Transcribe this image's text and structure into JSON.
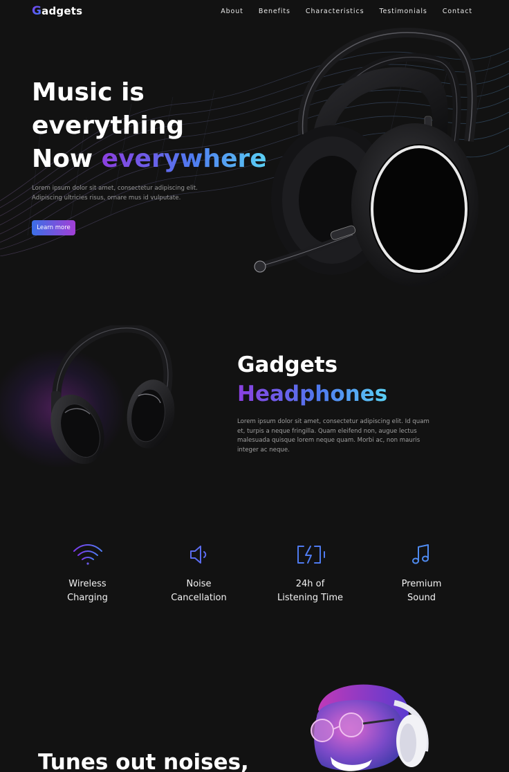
{
  "nav": {
    "logo_first": "G",
    "logo_rest": "adgets",
    "links": [
      "About",
      "Benefits",
      "Characteristics",
      "Testimonials",
      "Contact"
    ]
  },
  "hero": {
    "title_line1": "Music is",
    "title_line2": "everything",
    "title_line3_plain": "Now ",
    "title_line3_accent": "everywhere",
    "description": "Lorem ipsum dolor sit amet, consectetur adipiscing elit. Adipiscing ultricies risus, ornare mus id vulputate.",
    "button_label": "Learn more"
  },
  "product": {
    "title_line1": "Gadgets",
    "title_line2": "Headphones",
    "description": "Lorem ipsum dolor sit amet, consectetur adipiscing elit. Id quam et, turpis a neque fringilla. Quam eleifend non, augue lectus malesuada quisque lorem neque quam. Morbi ac, non mauris integer ac neque."
  },
  "features": [
    {
      "icon": "wifi-icon",
      "line1": "Wireless",
      "line2": "Charging"
    },
    {
      "icon": "speaker-icon",
      "line1": "Noise",
      "line2": "Cancellation"
    },
    {
      "icon": "battery-charging-icon",
      "line1": "24h of",
      "line2": "Listening Time"
    },
    {
      "icon": "music-note-icon",
      "line1": "Premium",
      "line2": "Sound"
    }
  ],
  "bottom": {
    "title": "Tunes out noises,"
  },
  "colors": {
    "background": "#121212",
    "accent_purple": "#8b3fe0",
    "accent_blue": "#4f7bf0",
    "accent_cyan": "#5bd1f5"
  }
}
